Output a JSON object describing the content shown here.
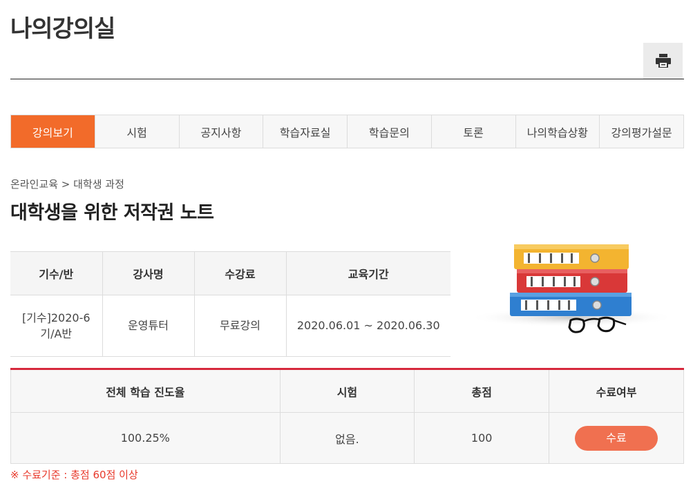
{
  "page": {
    "title": "나의강의실"
  },
  "toolbar": {
    "print_icon": "print-icon"
  },
  "tabs": [
    {
      "label": "강의보기",
      "active": true
    },
    {
      "label": "시험"
    },
    {
      "label": "공지사항"
    },
    {
      "label": "학습자료실"
    },
    {
      "label": "학습문의"
    },
    {
      "label": "토론"
    },
    {
      "label": "나의학습상황"
    },
    {
      "label": "강의평가설문"
    }
  ],
  "breadcrumb": "온라인교육 > 대학생 과정",
  "course": {
    "title": "대학생을 위한 저작권 노트"
  },
  "info_table": {
    "headers": [
      "기수/반",
      "강사명",
      "수강료",
      "교육기간"
    ],
    "row": [
      "[기수]2020-6기/A반",
      "운영튜터",
      "무료강의",
      "2020.06.01 ~ 2020.06.30"
    ]
  },
  "result_table": {
    "headers": [
      "전체 학습 진도율",
      "시험",
      "총점",
      "수료여부"
    ],
    "row": {
      "progress": "100.25%",
      "exam": "없음.",
      "score": "100",
      "completion": "수료"
    }
  },
  "criteria_note": "※ 수료기준 : 총점 60점 이상",
  "colors": {
    "accent_orange": "#f26b2a",
    "badge": "#f07050",
    "red_rule": "#d6283c",
    "note_red": "#e8392b"
  }
}
